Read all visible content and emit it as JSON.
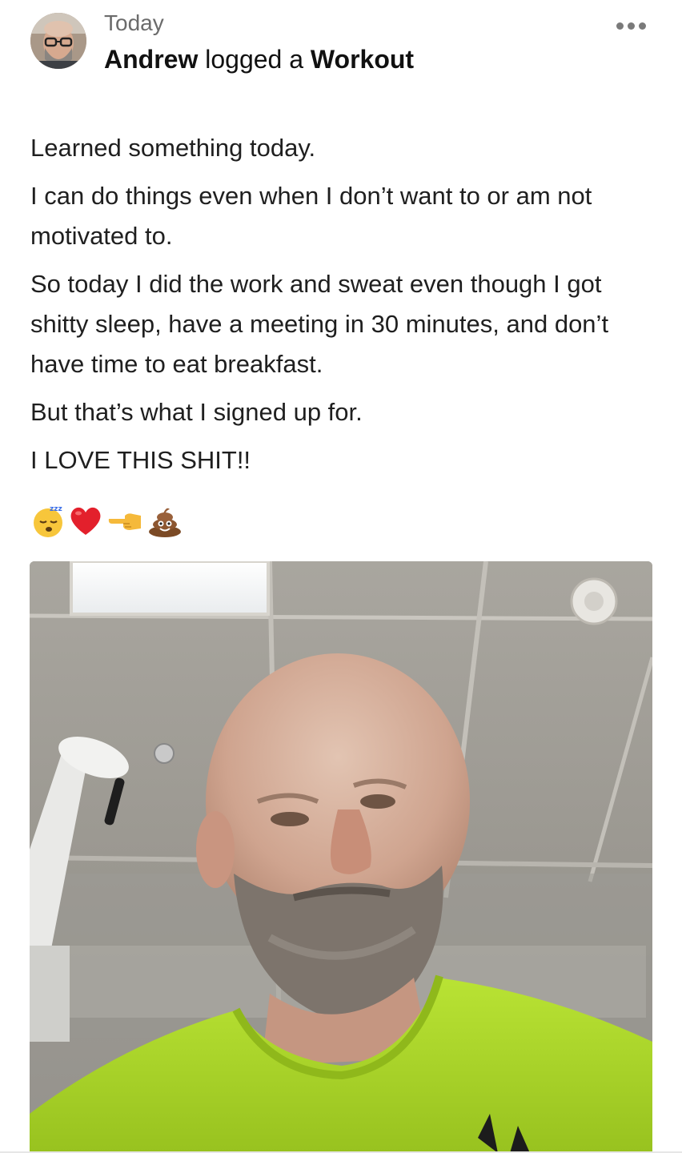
{
  "post": {
    "timestamp": "Today",
    "author": "Andrew",
    "action_text": " logged a ",
    "activity_type": "Workout",
    "more_icon": "more-horizontal-icon",
    "paragraphs": [
      "Learned something today.",
      "I can do things even when I don’t want to or am not motivated to.",
      "So today I did the work and sweat even though I got shitty sleep, have a meeting in 30 minutes, and don’t have time to eat breakfast.",
      "But that’s what I signed up for.",
      "I LOVE THIS SHIT!!"
    ],
    "emojis": [
      "sleeping-face-emoji",
      "red-heart-emoji",
      "pointing-left-emoji",
      "pile-of-poo-emoji"
    ],
    "colors": {
      "shirt": "#b4e22f",
      "timestamp": "#6b6b6b",
      "text": "#1f1f1f"
    }
  }
}
